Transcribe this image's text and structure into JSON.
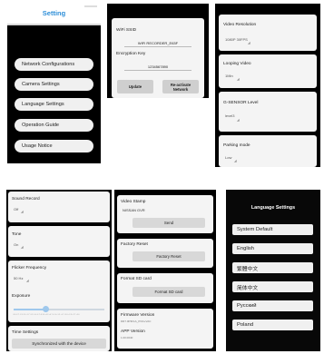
{
  "screen1": {
    "title": "Setting",
    "menu": [
      "Network Configurations",
      "Camera Settings",
      "Language Settings",
      "Operation Guide",
      "Usage Notice"
    ]
  },
  "screen2": {
    "ssid_label": "WiFi SSID",
    "ssid_value": "WIFI RECORDER_E63F",
    "key_label": "Encryption Key",
    "key_value": "1234567890",
    "update_button": "Update",
    "reactivate_button_line1": "Re-activate",
    "reactivate_button_line2": "Network"
  },
  "screen3": {
    "settings": [
      {
        "label": "Video Resolution",
        "value": "1080P 30FPS"
      },
      {
        "label": "Looping Video",
        "value": "1Min"
      },
      {
        "label": "G-SENSOR Level",
        "value": "level3"
      },
      {
        "label": "Parking mode",
        "value": "Low"
      }
    ]
  },
  "screen4": {
    "sound_label": "Sound Record",
    "sound_value": "Off",
    "tone_label": "Tone",
    "tone_value": "On",
    "flicker_label": "Flicker Frequency",
    "flicker_value": "50 Hz",
    "exposure_label": "Exposure",
    "exposure_level": 0.35,
    "exposure_scale": "-3.0 -2.7 -2.3 -2.0 -1.7 -1.3 -1.0 -0.7 -0.3 0 +0.3 +0.7 +1.0 +1.3 +1.7 +2.0 +2.3 +2.7 +3.0",
    "time_label": "Time Settings",
    "time_button": "Synchronized with the device"
  },
  "screen5": {
    "stamp_label": "Video Stamp",
    "stamp_value": "NISSAN GVR",
    "send_button": "Send",
    "reset_label": "Factory Reset",
    "reset_button": "Factory Reset",
    "format_label": "Format SD card",
    "format_button": "Format SD card",
    "firmware_label": "Firmware Version",
    "firmware_value": "DR7.0P3F1A_PCD+VAC",
    "app_label": "APP Version",
    "app_value": "1.00.0040"
  },
  "screen6": {
    "title": "Language Settings",
    "languages": [
      "System Default",
      "English",
      "繁體中文",
      "简体中文",
      "Русский",
      "Poland"
    ]
  },
  "colors": {
    "accent": "#2f8fd8",
    "slider": "#9fc8ec"
  }
}
